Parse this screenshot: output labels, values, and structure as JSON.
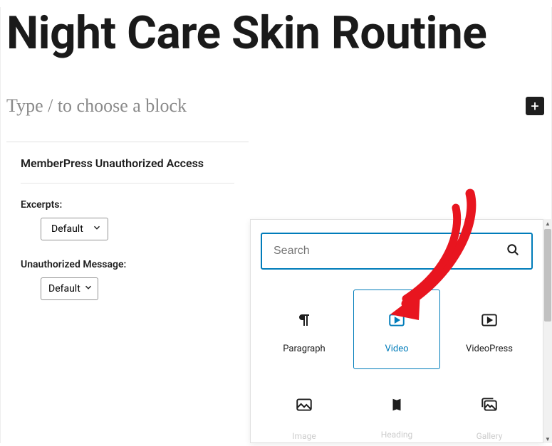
{
  "post": {
    "title": "Night Care Skin Routine",
    "placeholder": "Type / to choose a block"
  },
  "add_button_glyph": "+",
  "memberpress": {
    "header": "MemberPress Unauthorized Access",
    "excerpts_label": "Excerpts:",
    "excerpts_value": "Default",
    "unauth_label": "Unauthorized Message:",
    "unauth_value": "Default"
  },
  "inserter": {
    "search_placeholder": "Search",
    "blocks": {
      "paragraph": "Paragraph",
      "video": "Video",
      "videopress": "VideoPress",
      "image": "Image",
      "heading": "Heading",
      "gallery": "Gallery"
    }
  }
}
